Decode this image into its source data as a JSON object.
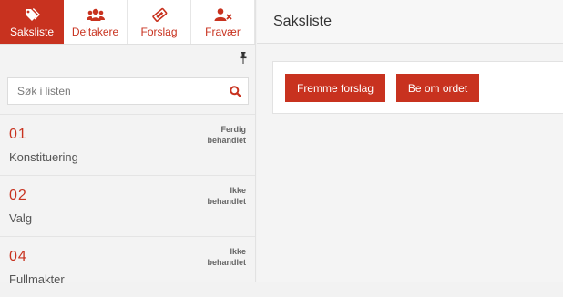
{
  "colors": {
    "accent": "#c8321f",
    "background": "#f2f2f2"
  },
  "tabs": [
    {
      "label": "Saksliste",
      "icon": "tags-icon",
      "active": true
    },
    {
      "label": "Deltakere",
      "icon": "users-icon",
      "active": false
    },
    {
      "label": "Forslag",
      "icon": "ticket-icon",
      "active": false
    },
    {
      "label": "Fravær",
      "icon": "user-remove-icon",
      "active": false
    }
  ],
  "search": {
    "placeholder": "Søk i listen",
    "value": ""
  },
  "items": [
    {
      "number": "01",
      "title": "Konstituering",
      "status_line1": "Ferdig",
      "status_line2": "behandlet"
    },
    {
      "number": "02",
      "title": "Valg",
      "status_line1": "Ikke",
      "status_line2": "behandlet"
    },
    {
      "number": "04",
      "title": "Fullmakter",
      "status_line1": "Ikke",
      "status_line2": "behandlet"
    }
  ],
  "header": {
    "title": "Saksliste"
  },
  "actions": {
    "propose_label": "Fremme forslag",
    "request_word_label": "Be om ordet"
  }
}
